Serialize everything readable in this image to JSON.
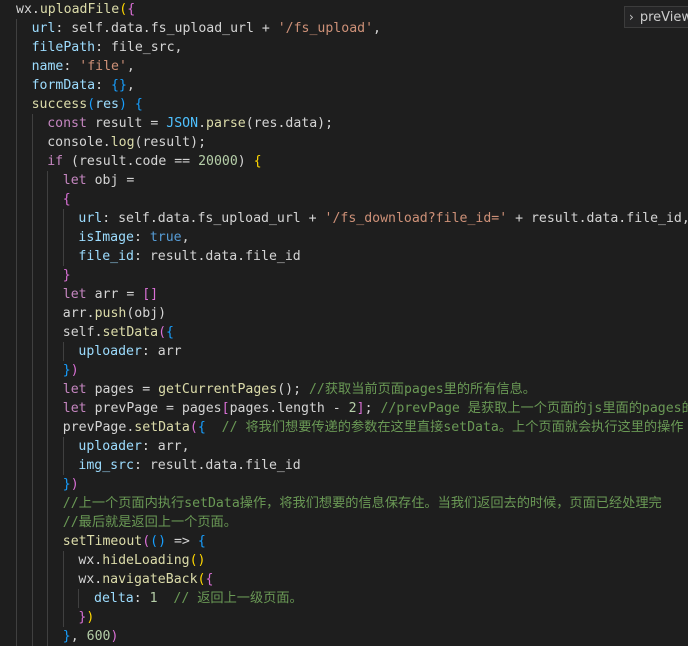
{
  "editor": {
    "lines": [
      {
        "indent": 0,
        "tokens": [
          [
            "wx",
            "plain"
          ],
          [
            ".",
            "plain"
          ],
          [
            "uploadFile",
            "fn"
          ],
          [
            "(",
            "br1"
          ],
          [
            "{",
            "br2"
          ]
        ]
      },
      {
        "indent": 1,
        "tokens": [
          [
            "url",
            "var"
          ],
          [
            ": self.data.fs_upload_url + ",
            "plain"
          ],
          [
            "'/fs_upload'",
            "str"
          ],
          [
            ",",
            "plain"
          ]
        ]
      },
      {
        "indent": 1,
        "tokens": [
          [
            "filePath",
            "var"
          ],
          [
            ": file_src,",
            "plain"
          ]
        ]
      },
      {
        "indent": 1,
        "tokens": [
          [
            "name",
            "var"
          ],
          [
            ": ",
            "plain"
          ],
          [
            "'file'",
            "str"
          ],
          [
            ",",
            "plain"
          ]
        ]
      },
      {
        "indent": 1,
        "tokens": [
          [
            "formData",
            "var"
          ],
          [
            ": ",
            "plain"
          ],
          [
            "{}",
            "br3"
          ],
          [
            ",",
            "plain"
          ]
        ]
      },
      {
        "indent": 1,
        "tokens": [
          [
            "success",
            "fn"
          ],
          [
            "(",
            "br3"
          ],
          [
            "res",
            "var"
          ],
          [
            ")",
            "br3"
          ],
          [
            " ",
            "plain"
          ],
          [
            "{",
            "br3"
          ]
        ]
      },
      {
        "indent": 2,
        "tokens": [
          [
            "const",
            "kw"
          ],
          [
            " result = ",
            "plain"
          ],
          [
            "JSON",
            "const"
          ],
          [
            ".",
            "plain"
          ],
          [
            "parse",
            "fn"
          ],
          [
            "(res.data);",
            "plain"
          ]
        ]
      },
      {
        "indent": 2,
        "tokens": [
          [
            "console",
            "plain"
          ],
          [
            ".",
            "plain"
          ],
          [
            "log",
            "fn"
          ],
          [
            "(result);",
            "plain"
          ]
        ]
      },
      {
        "indent": 2,
        "tokens": [
          [
            "if",
            "key"
          ],
          [
            " (result.code == ",
            "plain"
          ],
          [
            "20000",
            "num"
          ],
          [
            ") ",
            "plain"
          ],
          [
            "{",
            "br1"
          ]
        ]
      },
      {
        "indent": 3,
        "tokens": [
          [
            "let",
            "kw"
          ],
          [
            " obj =",
            "plain"
          ]
        ]
      },
      {
        "indent": 3,
        "tokens": [
          [
            "{",
            "br2"
          ]
        ]
      },
      {
        "indent": 4,
        "tokens": [
          [
            "url",
            "var"
          ],
          [
            ": self.data.fs_upload_url + ",
            "plain"
          ],
          [
            "'/fs_download?file_id='",
            "str"
          ],
          [
            " + result.data.file_id,",
            "plain"
          ]
        ]
      },
      {
        "indent": 4,
        "tokens": [
          [
            "isImage",
            "var"
          ],
          [
            ": ",
            "plain"
          ],
          [
            "true",
            "bool"
          ],
          [
            ",",
            "plain"
          ]
        ]
      },
      {
        "indent": 4,
        "tokens": [
          [
            "file_id",
            "var"
          ],
          [
            ": result.data.file_id",
            "plain"
          ]
        ]
      },
      {
        "indent": 3,
        "tokens": [
          [
            "}",
            "br2"
          ]
        ]
      },
      {
        "indent": 3,
        "tokens": [
          [
            "let",
            "kw"
          ],
          [
            " arr = ",
            "plain"
          ],
          [
            "[]",
            "br2"
          ]
        ]
      },
      {
        "indent": 3,
        "tokens": [
          [
            "arr",
            "plain"
          ],
          [
            ".",
            "plain"
          ],
          [
            "push",
            "fn"
          ],
          [
            "(obj)",
            "plain"
          ]
        ]
      },
      {
        "indent": 3,
        "tokens": [
          [
            "self",
            "plain"
          ],
          [
            ".",
            "plain"
          ],
          [
            "setData",
            "fn"
          ],
          [
            "(",
            "br2"
          ],
          [
            "{",
            "br3"
          ]
        ]
      },
      {
        "indent": 4,
        "tokens": [
          [
            "uploader",
            "var"
          ],
          [
            ": arr",
            "plain"
          ]
        ]
      },
      {
        "indent": 3,
        "tokens": [
          [
            "}",
            "br3"
          ],
          [
            ")",
            "br2"
          ]
        ]
      },
      {
        "indent": 3,
        "tokens": [
          [
            "let",
            "kw"
          ],
          [
            " pages = ",
            "plain"
          ],
          [
            "getCurrentPages",
            "fn"
          ],
          [
            "();",
            "plain"
          ],
          [
            " //获取当前页面pages里的所有信息。",
            "com"
          ]
        ]
      },
      {
        "indent": 3,
        "tokens": [
          [
            "let",
            "kw"
          ],
          [
            " prevPage = pages",
            "plain"
          ],
          [
            "[",
            "br2"
          ],
          [
            "pages.length - ",
            "plain"
          ],
          [
            "2",
            "num"
          ],
          [
            "]",
            "br2"
          ],
          [
            ";",
            "plain"
          ],
          [
            " //prevPage 是获取上一个页面的js里面的pages的",
            "com"
          ]
        ]
      },
      {
        "indent": 3,
        "tokens": [
          [
            "prevPage",
            "plain"
          ],
          [
            ".",
            "plain"
          ],
          [
            "setData",
            "fn"
          ],
          [
            "(",
            "br2"
          ],
          [
            "{",
            "br3"
          ],
          [
            "  // 将我们想要传递的参数在这里直接setData。上个页面就会执行这里的操作",
            "com"
          ]
        ]
      },
      {
        "indent": 4,
        "tokens": [
          [
            "uploader",
            "var"
          ],
          [
            ": arr,",
            "plain"
          ]
        ]
      },
      {
        "indent": 4,
        "tokens": [
          [
            "img_src",
            "var"
          ],
          [
            ": result.data.file_id",
            "plain"
          ]
        ]
      },
      {
        "indent": 3,
        "tokens": [
          [
            "}",
            "br3"
          ],
          [
            ")",
            "br2"
          ]
        ]
      },
      {
        "indent": 3,
        "tokens": [
          [
            "//上一个页面内执行setData操作，将我们想要的信息保存住。当我们返回去的时候，页面已经处理完",
            "com"
          ]
        ]
      },
      {
        "indent": 3,
        "tokens": [
          [
            "//最后就是返回上一个页面。",
            "com"
          ]
        ]
      },
      {
        "indent": 3,
        "tokens": [
          [
            "setTimeout",
            "fn"
          ],
          [
            "(",
            "br2"
          ],
          [
            "()",
            "br3"
          ],
          [
            " => ",
            "plain"
          ],
          [
            "{",
            "br3"
          ]
        ]
      },
      {
        "indent": 4,
        "tokens": [
          [
            "wx",
            "plain"
          ],
          [
            ".",
            "plain"
          ],
          [
            "hideLoading",
            "fn"
          ],
          [
            "()",
            "br1"
          ]
        ]
      },
      {
        "indent": 4,
        "tokens": [
          [
            "wx",
            "plain"
          ],
          [
            ".",
            "plain"
          ],
          [
            "navigateBack",
            "fn"
          ],
          [
            "(",
            "br1"
          ],
          [
            "{",
            "br2"
          ]
        ]
      },
      {
        "indent": 5,
        "tokens": [
          [
            "delta",
            "var"
          ],
          [
            ": ",
            "plain"
          ],
          [
            "1",
            "num"
          ],
          [
            "  // 返回上一级页面。",
            "com"
          ]
        ]
      },
      {
        "indent": 4,
        "tokens": [
          [
            "}",
            "br2"
          ],
          [
            ")",
            "br1"
          ]
        ]
      },
      {
        "indent": 3,
        "tokens": [
          [
            "}",
            "br3"
          ],
          [
            ", ",
            "plain"
          ],
          [
            "600",
            "num"
          ],
          [
            ")",
            "br2"
          ]
        ]
      }
    ]
  },
  "hover": {
    "chevron": "›",
    "label": "preView"
  }
}
